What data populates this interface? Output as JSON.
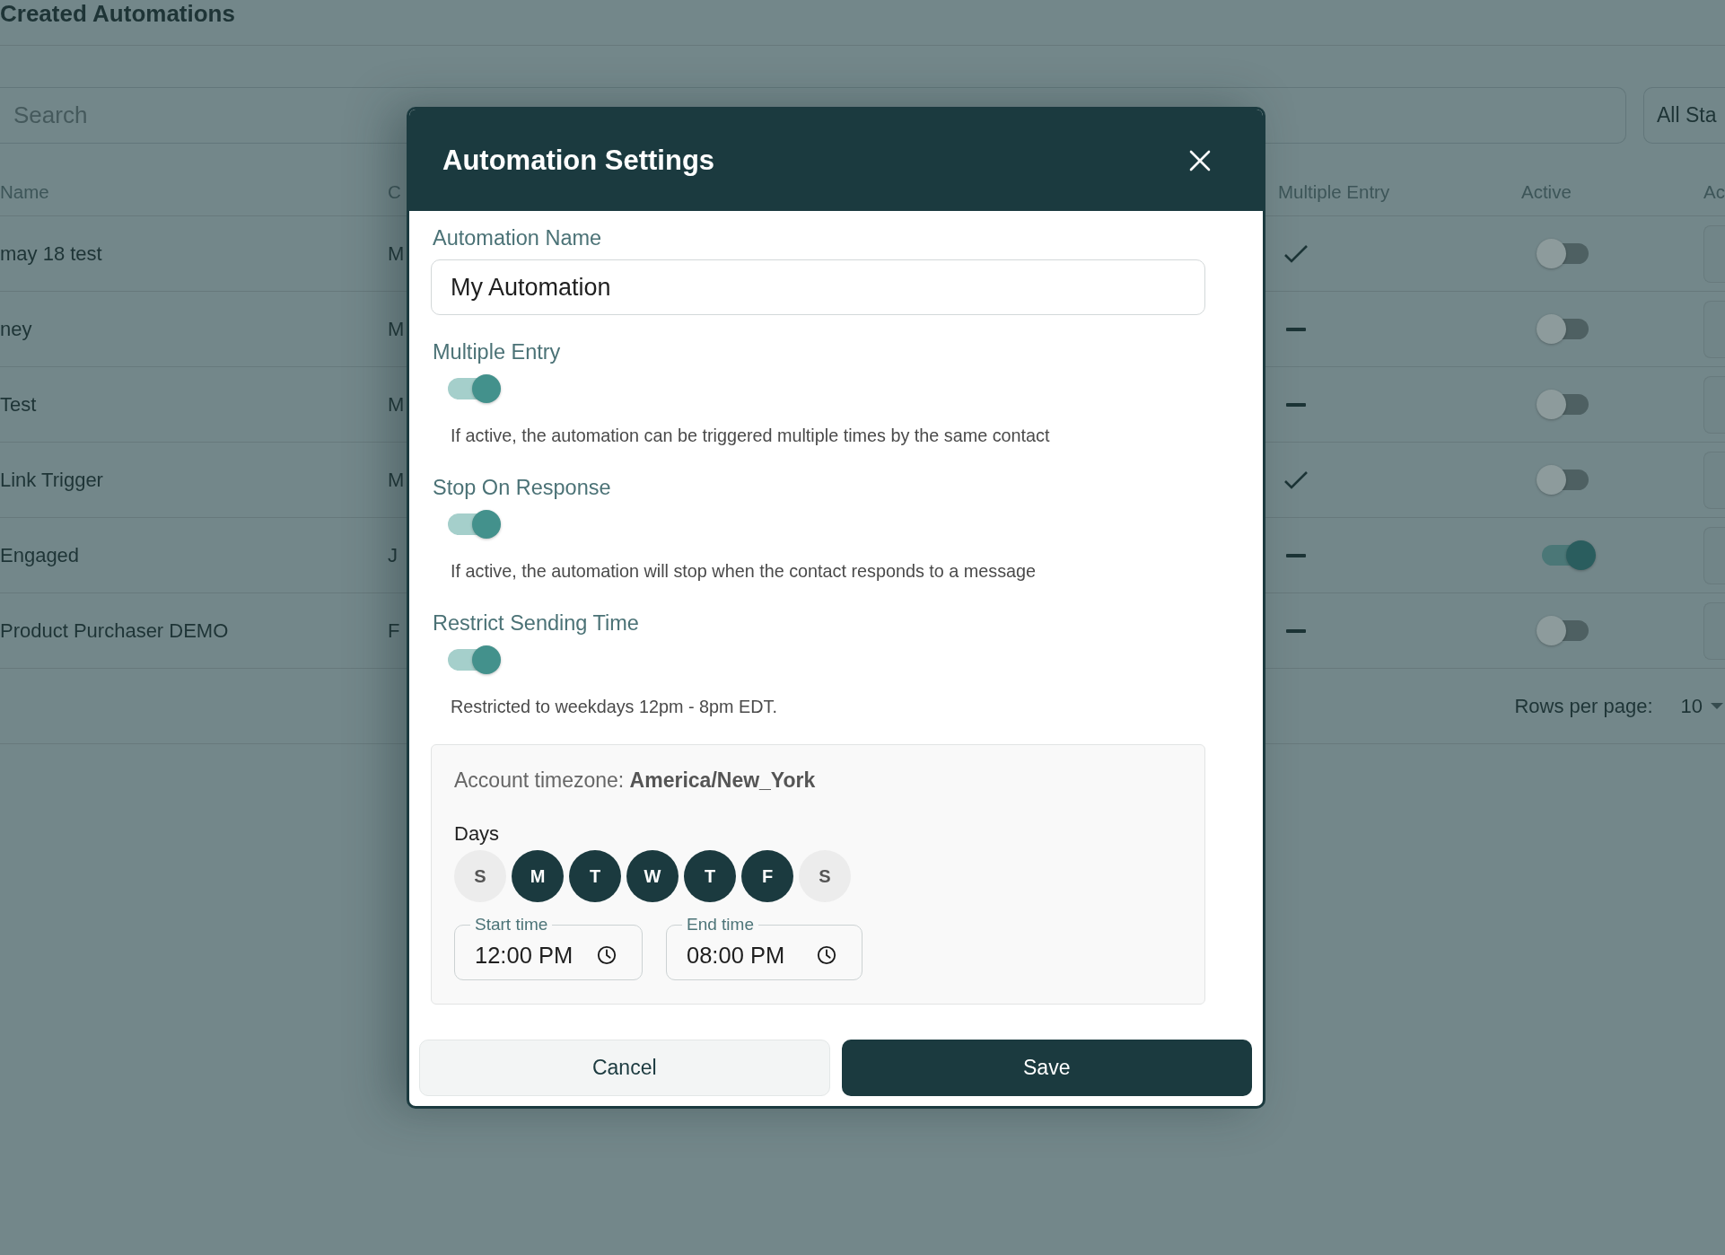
{
  "page": {
    "title": "Created Automations"
  },
  "toolbar": {
    "search": {
      "placeholder": "Search"
    },
    "status_filter": {
      "value": "All Sta"
    }
  },
  "table": {
    "columns": [
      "Name",
      "C",
      "Multiple Entry",
      "Active",
      "Ac"
    ],
    "rows": [
      {
        "name": "may 18 test",
        "column_2": "M",
        "multiple_entry": true,
        "active": false
      },
      {
        "name": "ney",
        "column_2": "M",
        "multiple_entry": false,
        "active": false
      },
      {
        "name": "Test",
        "column_2": "M",
        "multiple_entry": false,
        "active": false
      },
      {
        "name": "Link Trigger",
        "column_2": "M",
        "multiple_entry": true,
        "active": false
      },
      {
        "name": "Engaged",
        "column_2": "J",
        "multiple_entry": false,
        "active": true
      },
      {
        "name": "Product Purchaser DEMO",
        "column_2": "F",
        "multiple_entry": false,
        "active": false
      }
    ]
  },
  "pagination": {
    "label": "Rows per page:",
    "value": "10"
  },
  "modal": {
    "title": "Automation Settings",
    "name_field": {
      "label": "Automation Name",
      "value": "My Automation"
    },
    "settings": [
      {
        "label": "Multiple Entry",
        "on": true,
        "help": "If active, the automation can be triggered multiple times by the same contact"
      },
      {
        "label": "Stop On Response",
        "on": true,
        "help": "If active, the automation will stop when the contact responds to a message"
      },
      {
        "label": "Restrict Sending Time",
        "on": true,
        "help": "Restricted to weekdays 12pm - 8pm EDT."
      }
    ],
    "schedule": {
      "timezone": "Account timezone: **America/New_York**",
      "days_label": "Days",
      "days": [
        {
          "label": "S",
          "selected": false
        },
        {
          "label": "M",
          "selected": true
        },
        {
          "label": "T",
          "selected": true
        },
        {
          "label": "W",
          "selected": true
        },
        {
          "label": "T",
          "selected": true
        },
        {
          "label": "F",
          "selected": true
        },
        {
          "label": "S",
          "selected": false
        }
      ],
      "times": [
        {
          "label": "Start time",
          "value": "12:00 PM"
        },
        {
          "label": "End time",
          "value": "08:00 PM"
        }
      ]
    },
    "buttons": [
      {
        "label": "Cancel",
        "kind": "secondary"
      },
      {
        "label": "Save",
        "kind": "primary"
      }
    ]
  }
}
